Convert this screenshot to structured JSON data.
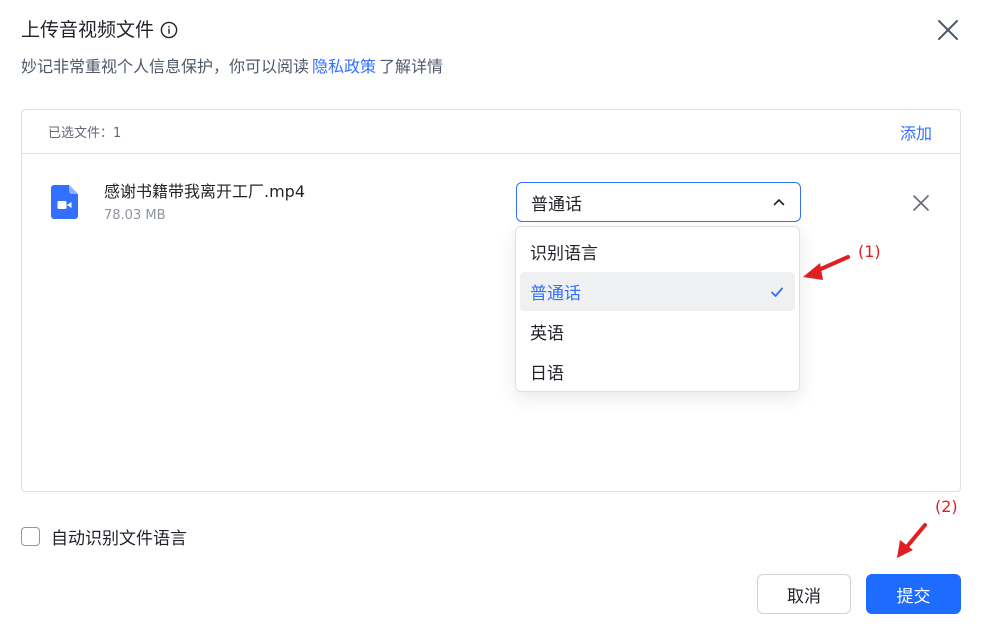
{
  "dialog": {
    "title": "上传音视频文件",
    "subtitle_prefix": "妙记非常重视个人信息保护，你可以阅读",
    "privacy_link": "隐私政策",
    "subtitle_suffix": "了解详情"
  },
  "panel": {
    "selected_label": "已选文件：1",
    "add_label": "添加",
    "file": {
      "name": "感谢书籍带我离开工厂.mp4",
      "size": "78.03 MB",
      "language": "普通话"
    }
  },
  "dropdown": {
    "options": [
      "识别语言",
      "普通话",
      "英语",
      "日语"
    ],
    "selected": "普通话"
  },
  "auto_detect_label": "自动识别文件语言",
  "buttons": {
    "cancel": "取消",
    "submit": "提交"
  },
  "annotations": {
    "one": "(1)",
    "two": "(2)"
  },
  "colors": {
    "accent": "#3370ff",
    "submit": "#1e6bff",
    "annotation": "#e02020"
  }
}
